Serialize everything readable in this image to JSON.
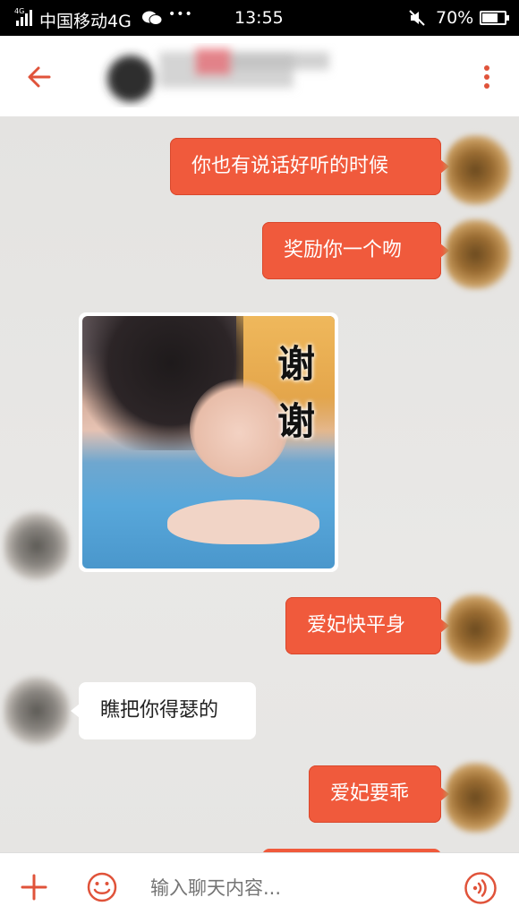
{
  "status_bar": {
    "network_badge": "4G",
    "carrier": "中国移动4G",
    "dots": "•••",
    "time": "13:55",
    "battery_percent": "70%",
    "battery_level": 0.7
  },
  "header": {
    "back_icon": "arrow-left-icon",
    "menu_icon": "more-vertical-icon"
  },
  "messages": [
    {
      "side": "me",
      "text": "你也有说话好听的时候"
    },
    {
      "side": "me",
      "text": "奖励你一个吻"
    },
    {
      "side": "other",
      "type": "sticker",
      "text": "谢谢"
    },
    {
      "side": "me",
      "text": "爱妃快平身"
    },
    {
      "side": "other",
      "text": "瞧把你得瑟的"
    },
    {
      "side": "me",
      "text": "爱妃要乖"
    }
  ],
  "sticker": {
    "line1": "谢",
    "line2": "谢"
  },
  "input_bar": {
    "placeholder": "输入聊天内容...",
    "plus_icon": "plus-icon",
    "emoji_icon": "emoji-icon",
    "voice_icon": "voice-icon"
  },
  "colors": {
    "accent": "#f05a3c",
    "bubble_other": "#ffffff",
    "status_bg": "#000000"
  }
}
